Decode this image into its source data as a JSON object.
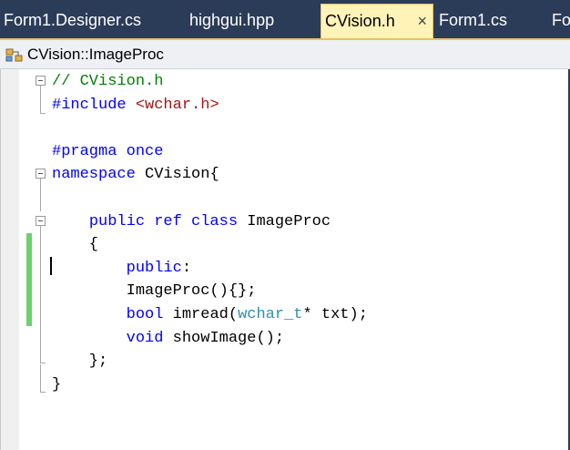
{
  "tabs": [
    {
      "label": "Form1.Designer.cs",
      "active": false
    },
    {
      "label": "highgui.hpp",
      "active": false
    },
    {
      "label": "CVision.h",
      "active": true,
      "close": "×"
    },
    {
      "label": "Form1.cs",
      "active": false
    },
    {
      "label": "Fo",
      "active": false
    }
  ],
  "navbar": {
    "class_name": "CVision::ImageProc",
    "icon": "class-icon"
  },
  "colors": {
    "chrome": "#2b3c59",
    "active_tab": "#fff3b8",
    "keyword": "#0000ff",
    "comment": "#008000",
    "string": "#a31515",
    "type": "#2b91af",
    "change_bar": "#6ad36a"
  },
  "code": [
    [
      {
        "t": "// CVision.h",
        "c": "cm"
      }
    ],
    [
      {
        "t": "#include ",
        "c": "kw"
      },
      {
        "t": "<wchar.h>",
        "c": "str"
      }
    ],
    [],
    [
      {
        "t": "#pragma once",
        "c": "kw"
      }
    ],
    [
      {
        "t": "namespace",
        "c": "kw"
      },
      {
        "t": " CVision{",
        "c": ""
      }
    ],
    [],
    [
      {
        "t": "    ",
        "c": ""
      },
      {
        "t": "public ref class",
        "c": "kw"
      },
      {
        "t": " ImageProc",
        "c": ""
      }
    ],
    [
      {
        "t": "    {",
        "c": ""
      }
    ],
    [
      {
        "t": "        ",
        "c": ""
      },
      {
        "t": "public",
        "c": "kw"
      },
      {
        "t": ":",
        "c": ""
      }
    ],
    [
      {
        "t": "        ImageProc(){};",
        "c": ""
      }
    ],
    [
      {
        "t": "        ",
        "c": ""
      },
      {
        "t": "bool",
        "c": "kw"
      },
      {
        "t": " imread(",
        "c": ""
      },
      {
        "t": "wchar_t",
        "c": "ty"
      },
      {
        "t": "* txt);",
        "c": ""
      }
    ],
    [
      {
        "t": "        ",
        "c": ""
      },
      {
        "t": "void",
        "c": "kw"
      },
      {
        "t": " showImage();",
        "c": ""
      }
    ],
    [
      {
        "t": "    };",
        "c": ""
      }
    ],
    [
      {
        "t": "}",
        "c": ""
      }
    ]
  ]
}
